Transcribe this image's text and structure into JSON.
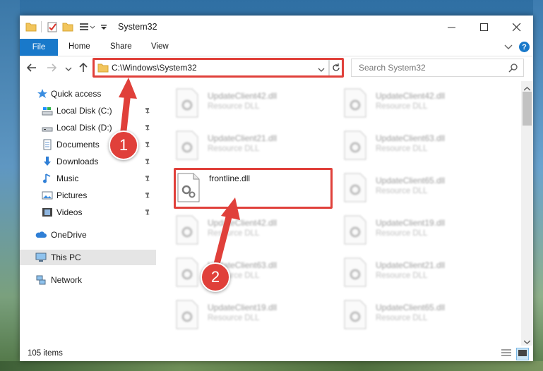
{
  "window": {
    "title": "System32",
    "controls": [
      "minimize-icon",
      "maximize-icon",
      "close-icon"
    ]
  },
  "ribbon": {
    "file": "File",
    "tabs": [
      "Home",
      "Share",
      "View"
    ],
    "help": "?"
  },
  "address": {
    "path": "C:\\Windows\\System32",
    "search_placeholder": "Search System32"
  },
  "nav": {
    "quick_access": "Quick access",
    "items": [
      {
        "label": "Local Disk (C:)",
        "icon": "drive-icon"
      },
      {
        "label": "Local Disk (D:)",
        "icon": "drive-icon"
      },
      {
        "label": "Documents",
        "icon": "documents-icon"
      },
      {
        "label": "Downloads",
        "icon": "downloads-icon"
      },
      {
        "label": "Music",
        "icon": "music-icon"
      },
      {
        "label": "Pictures",
        "icon": "pictures-icon"
      },
      {
        "label": "Videos",
        "icon": "videos-icon"
      }
    ],
    "onedrive": "OneDrive",
    "thispc": "This PC",
    "network": "Network"
  },
  "files": {
    "r0c0": {
      "name": "UpdateClient42.dll",
      "desc": "Resource DLL"
    },
    "r0c1": {
      "name": "UpdateClient42.dll",
      "desc": "Resource DLL"
    },
    "r1c0": {
      "name": "UpdateClient21.dll",
      "desc": "Resource DLL"
    },
    "r1c1": {
      "name": "UpdateClient63.dll",
      "desc": "Resource DLL"
    },
    "r2c0": {
      "name": "frontline.dll",
      "desc": ""
    },
    "r2c1": {
      "name": "UpdateClient65.dll",
      "desc": "Resource DLL"
    },
    "r3c0": {
      "name": "UpdateClient42.dll",
      "desc": "Resource DLL"
    },
    "r3c1": {
      "name": "UpdateClient19.dll",
      "desc": "Resource DLL"
    },
    "r4c0": {
      "name": "UpdateClient63.dll",
      "desc": "Resource DLL"
    },
    "r4c1": {
      "name": "UpdateClient21.dll",
      "desc": "Resource DLL"
    },
    "r5c0": {
      "name": "UpdateClient19.dll",
      "desc": "Resource DLL"
    },
    "r5c1": {
      "name": "UpdateClient65.dll",
      "desc": "Resource DLL"
    }
  },
  "status": {
    "count": "105 items"
  },
  "annotations": {
    "step1": "1",
    "step2": "2"
  },
  "colors": {
    "highlight": "#e0403a",
    "accent": "#1979ca"
  }
}
